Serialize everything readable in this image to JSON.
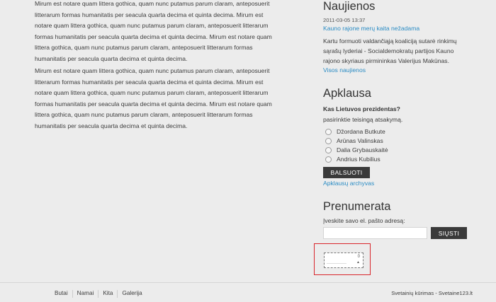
{
  "content": {
    "paragraph_1": "Mirum est notare quam littera gothica, quam nunc putamus parum claram, anteposuerit litterarum formas humanitatis per seacula quarta decima et quinta decima. Mirum est notare quam littera gothica, quam nunc putamus parum claram, anteposuerit litterarum formas humanitatis per seacula quarta decima et quinta decima. Mirum est notare quam littera gothica, quam nunc putamus parum claram, anteposuerit litterarum formas humanitatis per seacula quarta decima et quinta decima.",
    "paragraph_2": "Mirum est notare quam littera gothica, quam nunc putamus parum claram, anteposuerit litterarum formas humanitatis per seacula quarta decima et quinta decima. Mirum est notare quam littera gothica, quam nunc putamus parum claram, anteposuerit litterarum formas humanitatis per seacula quarta decima et quinta decima. Mirum est notare quam littera gothica, quam nunc putamus parum claram, anteposuerit litterarum formas humanitatis per seacula quarta decima et quinta decima."
  },
  "news": {
    "title": "Naujienos",
    "date": "2011-03-05 13:37",
    "headline": "Kauno rajone merų kaita nežadama",
    "body": "Kartu formuoti valdančiąją koaliciją sutarė rinkimų sąrašų lyderiai - Socialdemokratų partijos Kauno rajono skyriaus pirmininkas Valerijus Makūnas.",
    "all_link": "Visos naujienos"
  },
  "poll": {
    "title": "Apklausa",
    "question": "Kas Lietuvos prezidentas?",
    "hint": "pasirinktie teisingą atsakymą.",
    "options": [
      "Džordana Butkute",
      "Arūnas Valinskas",
      "Dalia Grybauskaitė",
      "Andrius Kubilius"
    ],
    "vote_button": "BALSUOTI",
    "archive_link": "Apklausų archyvas"
  },
  "subscribe": {
    "title": "Prenumerata",
    "label": "Įveskite savo el. pašto adresą:",
    "input_value": "",
    "send_button": "SIŲSTI"
  },
  "widget": {
    "count": "0",
    "arrow": "▲"
  },
  "footer": {
    "nav": [
      "Butai",
      "Namai",
      "Kita",
      "Galerija"
    ],
    "credit": "Svetainių kūrimas - Svetaine123.lt"
  },
  "colors": {
    "link": "#2b8cc4",
    "button_bg": "#3a3a3a",
    "highlight_border": "#d9262c"
  }
}
